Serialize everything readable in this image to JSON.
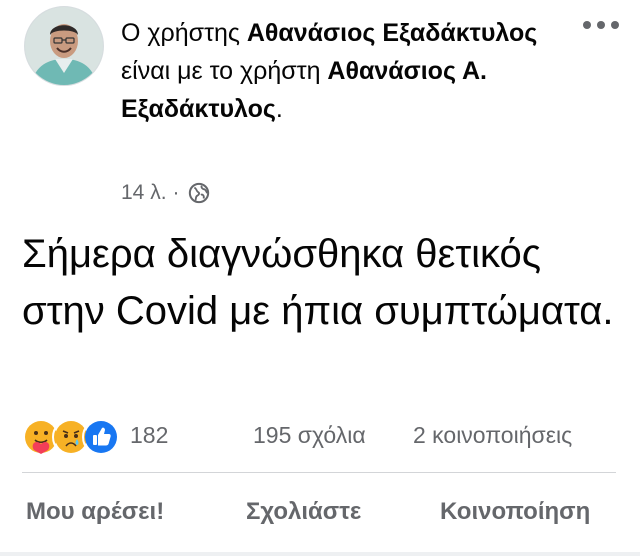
{
  "header": {
    "prefix": "Ο χρήστης ",
    "author": "Αθανάσιος Εξαδάκτυλος",
    "middle": " είναι με το χρήστη ",
    "tagged": "Αθανάσιος Α. Εξαδάκτυλος",
    "suffix": ".",
    "time": "14 λ.",
    "separator": "·",
    "privacy_icon": "globe-icon",
    "more_icon": "more-options-icon"
  },
  "post": {
    "text": "Σήμερα διαγνώσθηκα θετικός στην Covid με ήπια συμπτώματα."
  },
  "stats": {
    "reaction_icons": [
      "care-icon",
      "sad-icon",
      "like-icon"
    ],
    "reaction_count": "182",
    "comments": "195 σχόλια",
    "shares": "2 κοινοποιήσεις"
  },
  "actions": {
    "like": "Μου αρέσει!",
    "comment": "Σχολιάστε",
    "share": "Κοινοποίηση"
  },
  "colors": {
    "text_primary": "#050505",
    "text_secondary": "#65676b",
    "like_blue": "#1877f2",
    "reaction_yellow": "#f7b125",
    "divider": "#d3d5d8"
  }
}
